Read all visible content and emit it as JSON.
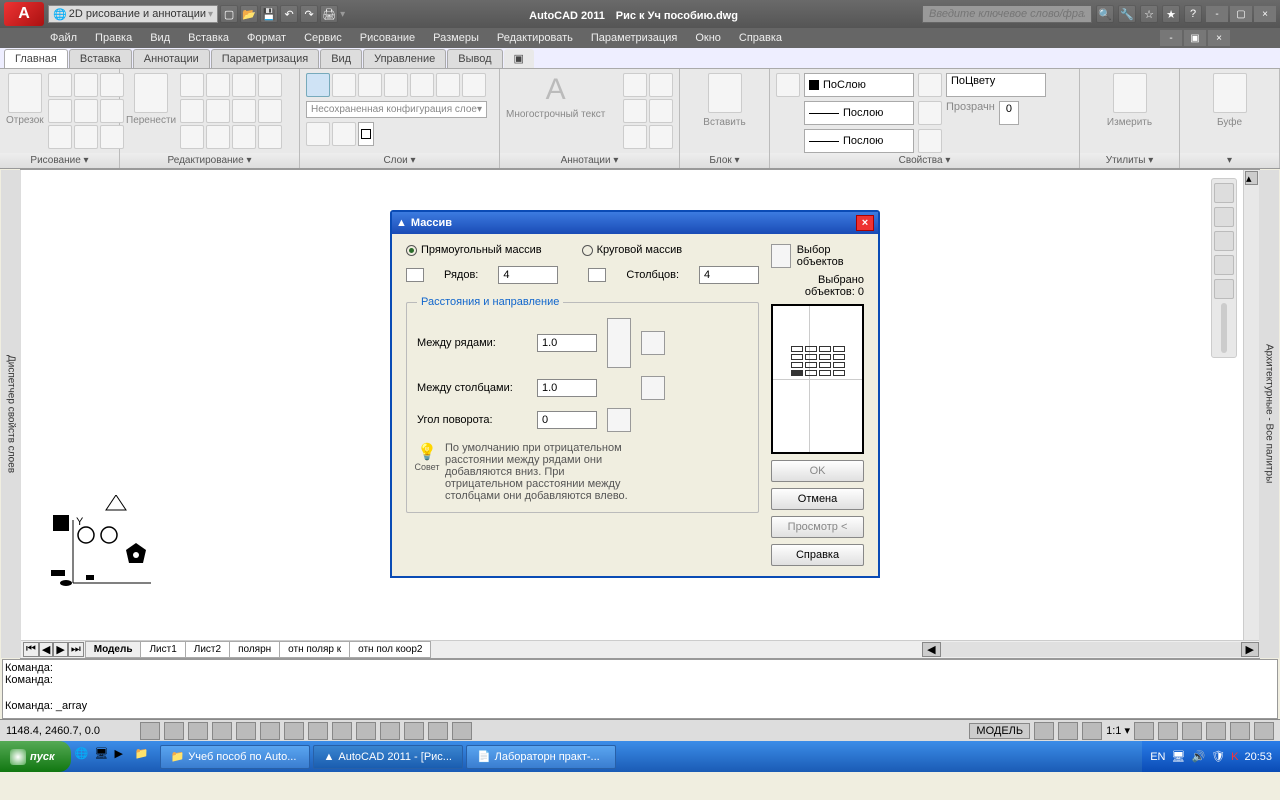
{
  "titlebar": {
    "qat_selector": "2D рисование и аннотации",
    "app_name": "AutoCAD 2011",
    "file_name": "Рис к Уч пособию.dwg",
    "search_placeholder": "Введите ключевое слово/фразу"
  },
  "menubar": [
    "Файл",
    "Правка",
    "Вид",
    "Вставка",
    "Формат",
    "Сервис",
    "Рисование",
    "Размеры",
    "Редактировать",
    "Параметризация",
    "Окно",
    "Справка"
  ],
  "tabs": [
    "Главная",
    "Вставка",
    "Аннотации",
    "Параметризация",
    "Вид",
    "Управление",
    "Вывод"
  ],
  "ribbon": {
    "g0": {
      "title": "Рисование ▾",
      "label": "Отрезок"
    },
    "g1": {
      "title": "Редактирование ▾",
      "label": "Перенести"
    },
    "g2": {
      "title": "Слои ▾",
      "combo": "Несохраненная конфигурация слое▾"
    },
    "g3": {
      "title": "Аннотации ▾",
      "label": "Многострочный текст",
      "big": "А"
    },
    "g4": {
      "title": "Блок ▾",
      "label": "Вставить"
    },
    "g5": {
      "title": "Свойства ▾",
      "bylayer": "ПоСлою",
      "bylayer2": "Послою",
      "bycolor": "ПоЦвету",
      "transp": "Прозрачн",
      "transp_val": "0"
    },
    "g6": {
      "title": "Утилиты ▾",
      "label": "Измерить"
    },
    "g7": {
      "title": "Буфе",
      "label": "Буфе"
    }
  },
  "leftpane": "Диспетчер свойств слоев",
  "rightpane": "Архитектурные - Все палитры",
  "layouts": [
    "Модель",
    "Лист1",
    "Лист2",
    "полярн",
    "отн поляр к",
    "отн пол коор2"
  ],
  "dialog": {
    "title": "Массив",
    "rect": "Прямоугольный массив",
    "polar": "Круговой массив",
    "selobj": "Выбор объектов",
    "selected": "Выбрано объектов: 0",
    "rows_lbl": "Рядов:",
    "rows_val": "4",
    "cols_lbl": "Столбцов:",
    "cols_val": "4",
    "group": "Расстояния и направление",
    "rowdist": "Между рядами:",
    "rowdist_val": "1.0",
    "coldist": "Между столбцами:",
    "coldist_val": "1.0",
    "angle": "Угол поворота:",
    "angle_val": "0",
    "tip_title": "Совет",
    "tip": "По умолчанию при отрицательном расстоянии между рядами они добавляются вниз. При отрицательном расстоянии между столбцами они добавляются влево.",
    "ok": "OK",
    "cancel": "Отмена",
    "preview": "Просмотр <",
    "help": "Справка"
  },
  "cmd": {
    "l1": "Команда:",
    "l2": "Команда:",
    "l3": "Команда:  _array"
  },
  "status": {
    "coords": "1148.4, 2460.7, 0.0",
    "model": "МОДЕЛЬ",
    "scale": "1:1 ▾"
  },
  "taskbar": {
    "start": "пуск",
    "tasks": [
      "Учеб пособ по Auto...",
      "AutoCAD 2011 - [Рис...",
      "Лабораторн практ-..."
    ],
    "lang": "EN",
    "time": "20:53"
  }
}
